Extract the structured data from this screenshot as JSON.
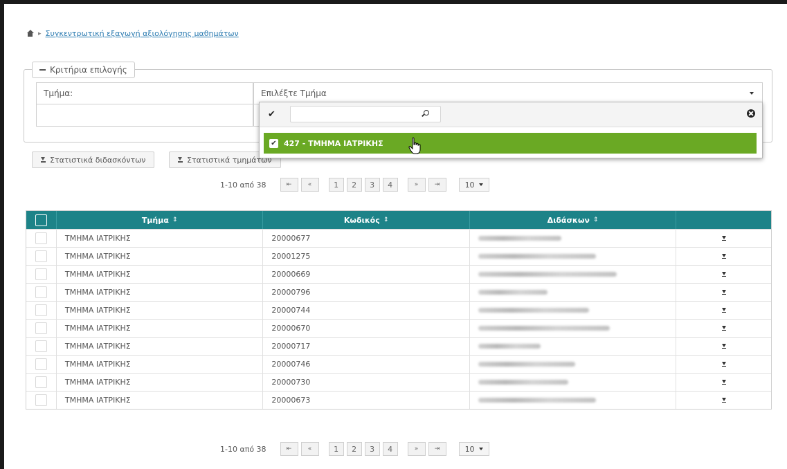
{
  "breadcrumb": {
    "link": "Συγκεντρωτική εξαγωγή αξιολόγησης μαθημάτων"
  },
  "criteria": {
    "legend": "Κριτήρια επιλογής",
    "department_label": "Τμήμα:",
    "department_placeholder": "Επιλέξτε Τμήμα"
  },
  "dropdown": {
    "option": "427 - ΤΜΗΜΑ ΙΑΤΡΙΚΗΣ"
  },
  "buttons": {
    "stats_teachers": "Στατιστικά διδασκόντων",
    "stats_departments": "Στατιστικά τμημάτων"
  },
  "pager": {
    "range": "1-10 από 38",
    "first": "⇤",
    "prev": "«",
    "pages": [
      "1",
      "2",
      "3",
      "4"
    ],
    "next": "»",
    "last": "⇥",
    "page_size": "10"
  },
  "table": {
    "headers": {
      "department": "Τμήμα",
      "code": "Κωδικός",
      "teacher": "Διδάσκων"
    },
    "sort_icon": "⇕",
    "rows": [
      {
        "department": "ΤΜΗΜΑ ΙΑΤΡΙΚΗΣ",
        "code": "20000677"
      },
      {
        "department": "ΤΜΗΜΑ ΙΑΤΡΙΚΗΣ",
        "code": "20001275"
      },
      {
        "department": "ΤΜΗΜΑ ΙΑΤΡΙΚΗΣ",
        "code": "20000669"
      },
      {
        "department": "ΤΜΗΜΑ ΙΑΤΡΙΚΗΣ",
        "code": "20000796"
      },
      {
        "department": "ΤΜΗΜΑ ΙΑΤΡΙΚΗΣ",
        "code": "20000744"
      },
      {
        "department": "ΤΜΗΜΑ ΙΑΤΡΙΚΗΣ",
        "code": "20000670"
      },
      {
        "department": "ΤΜΗΜΑ ΙΑΤΡΙΚΗΣ",
        "code": "20000717"
      },
      {
        "department": "ΤΜΗΜΑ ΙΑΤΡΙΚΗΣ",
        "code": "20000746"
      },
      {
        "department": "ΤΜΗΜΑ ΙΑΤΡΙΚΗΣ",
        "code": "20000730"
      },
      {
        "department": "ΤΜΗΜΑ ΙΑΤΡΙΚΗΣ",
        "code": "20000673"
      }
    ]
  },
  "colors": {
    "header_teal": "#1d8388",
    "option_green": "#6aa924",
    "link_blue": "#2a7ab0"
  }
}
